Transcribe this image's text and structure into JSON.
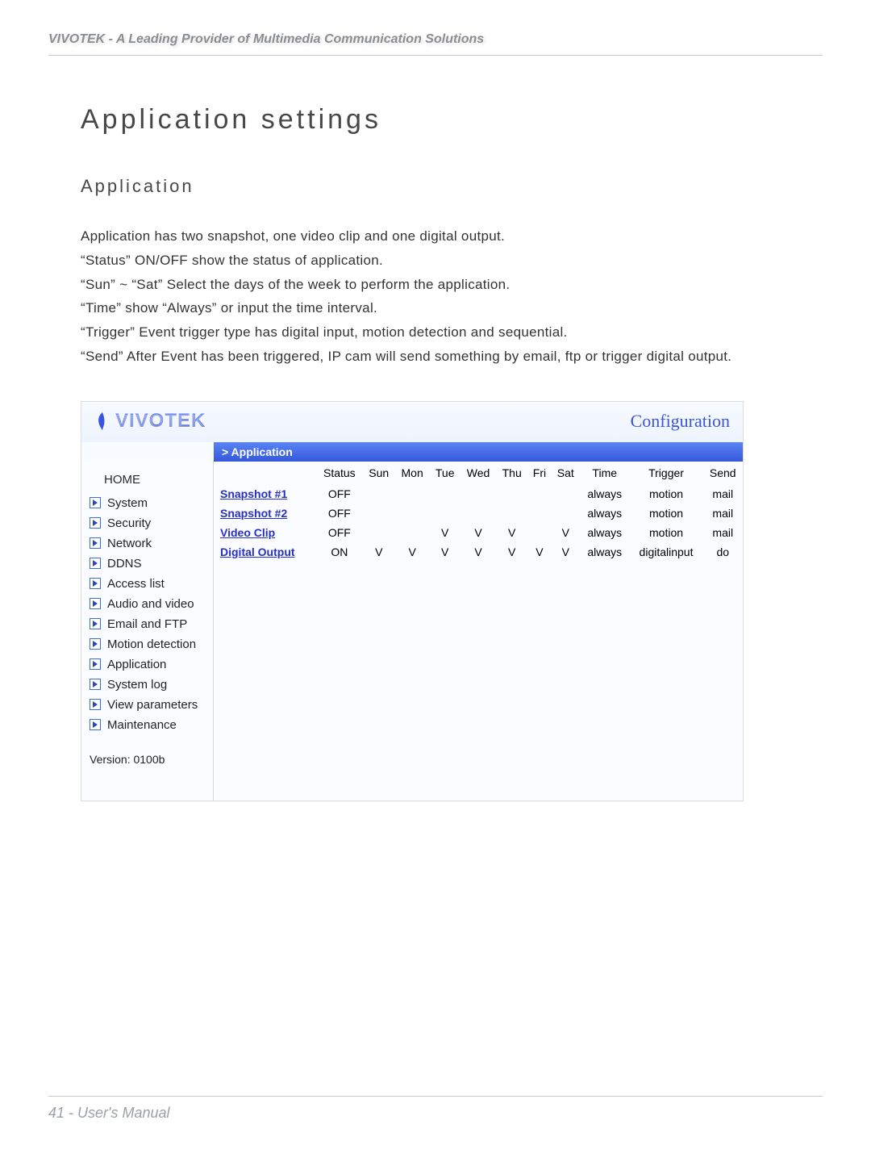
{
  "header": {
    "tagline": "VIVOTEK - A Leading Provider of Multimedia Communication Solutions"
  },
  "page": {
    "title": "Application settings",
    "section": "Application",
    "paragraphs": [
      "Application has two snapshot, one video clip and one digital output.",
      "“Status” ON/OFF show the status of application.",
      "“Sun” ~ “Sat” Select the days of the week to perform the application.",
      "“Time” show “Always” or input the time interval.",
      "“Trigger” Event trigger type has digital input, motion detection and sequential.",
      "“Send” After Event has been triggered, IP cam will send something by email, ftp or trigger digital output."
    ]
  },
  "screenshot": {
    "brand": "VIVOTEK",
    "config_label": "Configuration",
    "blue_bar": "> Application",
    "sidebar": {
      "home": "HOME",
      "items": [
        "System",
        "Security",
        "Network",
        "DDNS",
        "Access list",
        "Audio and video",
        "Email and FTP",
        "Motion detection",
        "Application",
        "System log",
        "View parameters",
        "Maintenance"
      ],
      "version": "Version: 0100b"
    },
    "table": {
      "headers": [
        "",
        "Status",
        "Sun",
        "Mon",
        "Tue",
        "Wed",
        "Thu",
        "Fri",
        "Sat",
        "Time",
        "Trigger",
        "Send"
      ],
      "rows": [
        {
          "name": "Snapshot #1",
          "status": "OFF",
          "days": [
            "",
            "",
            "",
            "",
            "",
            "",
            ""
          ],
          "time": "always",
          "trigger": "motion",
          "send": "mail"
        },
        {
          "name": "Snapshot #2",
          "status": "OFF",
          "days": [
            "",
            "",
            "",
            "",
            "",
            "",
            ""
          ],
          "time": "always",
          "trigger": "motion",
          "send": "mail"
        },
        {
          "name": "Video Clip",
          "status": "OFF",
          "days": [
            "",
            "",
            "V",
            "V",
            "V",
            "",
            "V"
          ],
          "time": "always",
          "trigger": "motion",
          "send": "mail"
        },
        {
          "name": "Digital Output",
          "status": "ON",
          "days": [
            "V",
            "V",
            "V",
            "V",
            "V",
            "V",
            "V"
          ],
          "time": "always",
          "trigger": "digitalinput",
          "send": "do"
        }
      ]
    }
  },
  "footer": {
    "page_number": "41",
    "label": "User's Manual"
  }
}
